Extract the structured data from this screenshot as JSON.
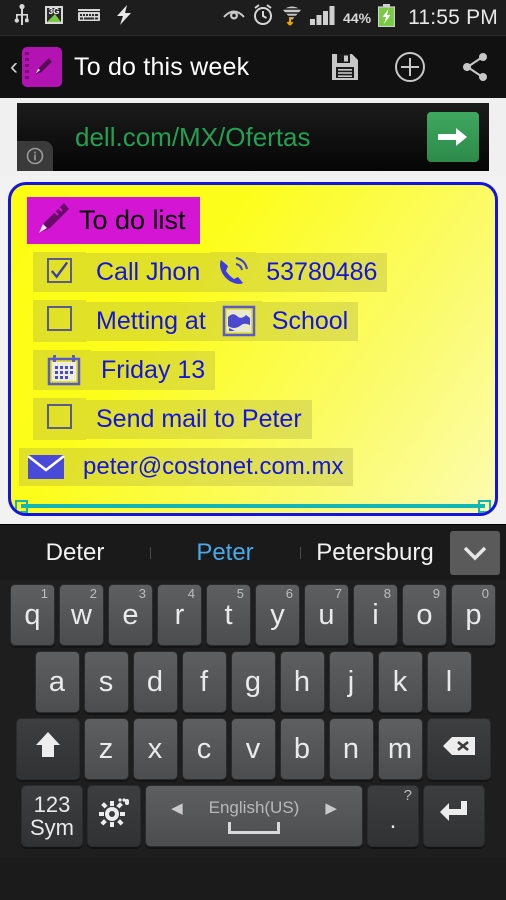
{
  "statusbar": {
    "icons": [
      "usb-icon",
      "3g-signal-icon",
      "keyboard-icon",
      "flash-icon"
    ],
    "right_icons": [
      "eye-icon",
      "alarm-icon",
      "wifi-icon",
      "cell-signal-icon"
    ],
    "battery_percent": "44%",
    "battery_state": "charging",
    "time": "11:55 PM"
  },
  "actionbar": {
    "back_label": "‹",
    "app_icon": "notepad-pen-icon",
    "title": "To do this week",
    "actions": [
      {
        "name": "save-button",
        "icon": "floppy-disk-icon"
      },
      {
        "name": "add-button",
        "icon": "plus-circle-icon"
      },
      {
        "name": "share-button",
        "icon": "share-icon"
      }
    ]
  },
  "ad": {
    "url": "dell.com/MX/Ofertas",
    "info_icon": "info-icon",
    "cta_icon": "arrow-right-icon",
    "url_color": "#25a052",
    "cta_color": "#3fa85f"
  },
  "note": {
    "background_color": "#fdfd12",
    "border_color": "#1414e0",
    "text_color": "#1414e0",
    "title": {
      "text": "To do list",
      "icon": "pencil-icon",
      "highlight_color": "#d416d4",
      "text_color": "#000000"
    },
    "items": [
      {
        "checkbox": "checked",
        "text": "Call Jhon",
        "icon": "phone-icon",
        "icon_text": "53780486"
      },
      {
        "checkbox": "unchecked",
        "text": "Metting at",
        "icon": "map-icon",
        "icon_text": "School"
      },
      {
        "checkbox": "none",
        "text": "Friday 13",
        "icon": "calendar-icon",
        "icon_text": ""
      },
      {
        "checkbox": "unchecked",
        "text": "Send mail to Peter",
        "icon": "",
        "icon_text": ""
      },
      {
        "checkbox": "none",
        "text": "peter@costonet.com.mx",
        "icon": "envelope-icon",
        "icon_text": ""
      }
    ]
  },
  "suggestions": {
    "items": [
      {
        "label": "Deter",
        "active": false
      },
      {
        "label": "Peter",
        "active": true
      },
      {
        "label": "Petersburg",
        "active": false
      }
    ],
    "expand_icon": "chevron-down-icon",
    "active_color": "#4aa8e8"
  },
  "keyboard": {
    "row1": [
      {
        "key": "q",
        "hint": "1"
      },
      {
        "key": "w",
        "hint": "2"
      },
      {
        "key": "e",
        "hint": "3"
      },
      {
        "key": "r",
        "hint": "4"
      },
      {
        "key": "t",
        "hint": "5"
      },
      {
        "key": "y",
        "hint": "6"
      },
      {
        "key": "u",
        "hint": "7"
      },
      {
        "key": "i",
        "hint": "8"
      },
      {
        "key": "o",
        "hint": "9"
      },
      {
        "key": "p",
        "hint": "0"
      }
    ],
    "row2": [
      {
        "key": "a"
      },
      {
        "key": "s"
      },
      {
        "key": "d"
      },
      {
        "key": "f"
      },
      {
        "key": "g"
      },
      {
        "key": "h"
      },
      {
        "key": "j"
      },
      {
        "key": "k"
      },
      {
        "key": "l"
      }
    ],
    "row3": [
      {
        "key": "z"
      },
      {
        "key": "x"
      },
      {
        "key": "c"
      },
      {
        "key": "v"
      },
      {
        "key": "b"
      },
      {
        "key": "n"
      },
      {
        "key": "m"
      }
    ],
    "shift_icon": "shift-arrow-icon",
    "backspace_icon": "backspace-icon",
    "sym_label_top": "123",
    "sym_label_bottom": "Sym",
    "settings_icon": "gear-icon",
    "space_language": "English(US)",
    "space_prev_icon": "triangle-left-icon",
    "space_next_icon": "triangle-right-icon",
    "period_key": ".",
    "period_hint": "?",
    "enter_icon": "enter-arrow-icon"
  }
}
